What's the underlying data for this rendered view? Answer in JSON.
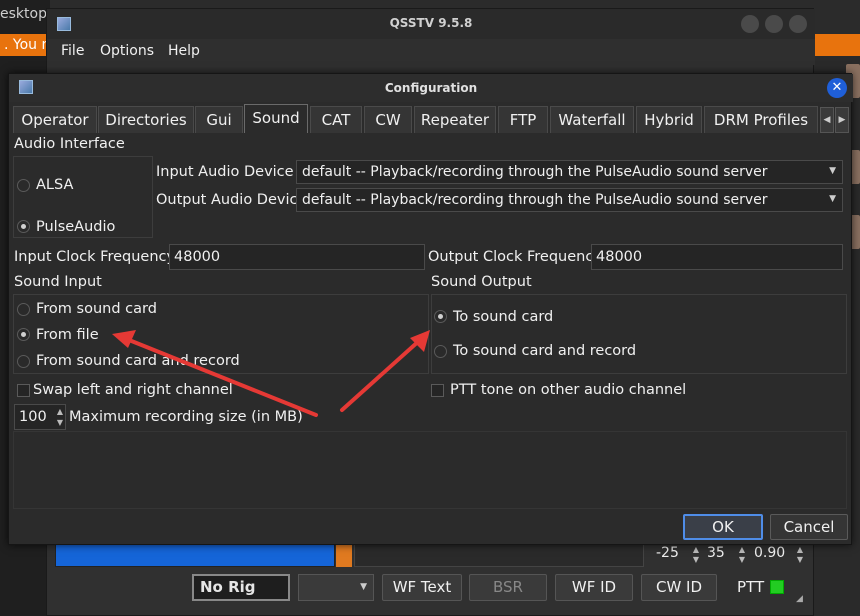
{
  "desktop": {
    "label": "esktop",
    "banner": ". You m"
  },
  "main_window": {
    "title": "QSSTV 9.5.8",
    "menu": [
      "File",
      "Options",
      "Help"
    ],
    "spin1": "-25",
    "spin2": "35",
    "spin3": "0.90",
    "buttons": {
      "rig": "No Rig",
      "wf_text": "WF Text",
      "bsr": "BSR",
      "wf_id": "WF ID",
      "cw_id": "CW ID",
      "ptt": "PTT"
    }
  },
  "dialog": {
    "title": "Configuration",
    "tabs": [
      "Operator",
      "Directories",
      "Gui",
      "Sound",
      "CAT",
      "CW",
      "Repeater",
      "FTP",
      "Waterfall",
      "Hybrid",
      "DRM Profiles"
    ],
    "active_tab": "Sound",
    "audio_interface": {
      "heading": "Audio Interface",
      "options": [
        "ALSA",
        "PulseAudio"
      ],
      "selected": "PulseAudio",
      "input_device_label": "Input Audio Device",
      "input_device_value": "default -- Playback/recording through the PulseAudio sound server",
      "output_device_label": "Output Audio Device",
      "output_device_value": "default -- Playback/recording through the PulseAudio sound server"
    },
    "clock": {
      "input_label": "Input  Clock Frequency",
      "input_value": "48000",
      "output_label": "Output Clock Frequency",
      "output_value": "48000"
    },
    "sound_input": {
      "heading": "Sound Input",
      "options": [
        "From sound card",
        "From file",
        "From sound card and record"
      ],
      "selected": "From file",
      "swap_label": "Swap left and right channel",
      "max_rec_value": "100",
      "max_rec_label": "Maximum recording size (in MB)"
    },
    "sound_output": {
      "heading": "Sound Output",
      "options": [
        "To sound card",
        "To sound card and record"
      ],
      "selected": "To sound card",
      "ptt_tone_label": "PTT tone on other audio channel"
    },
    "ok_label": "OK",
    "cancel_label": "Cancel"
  },
  "colors": {
    "accent": "#4f8de8",
    "arrow": "#e53935",
    "banner": "#e8730d",
    "meter": "#1565d8",
    "ptt_led": "#22cc22"
  }
}
